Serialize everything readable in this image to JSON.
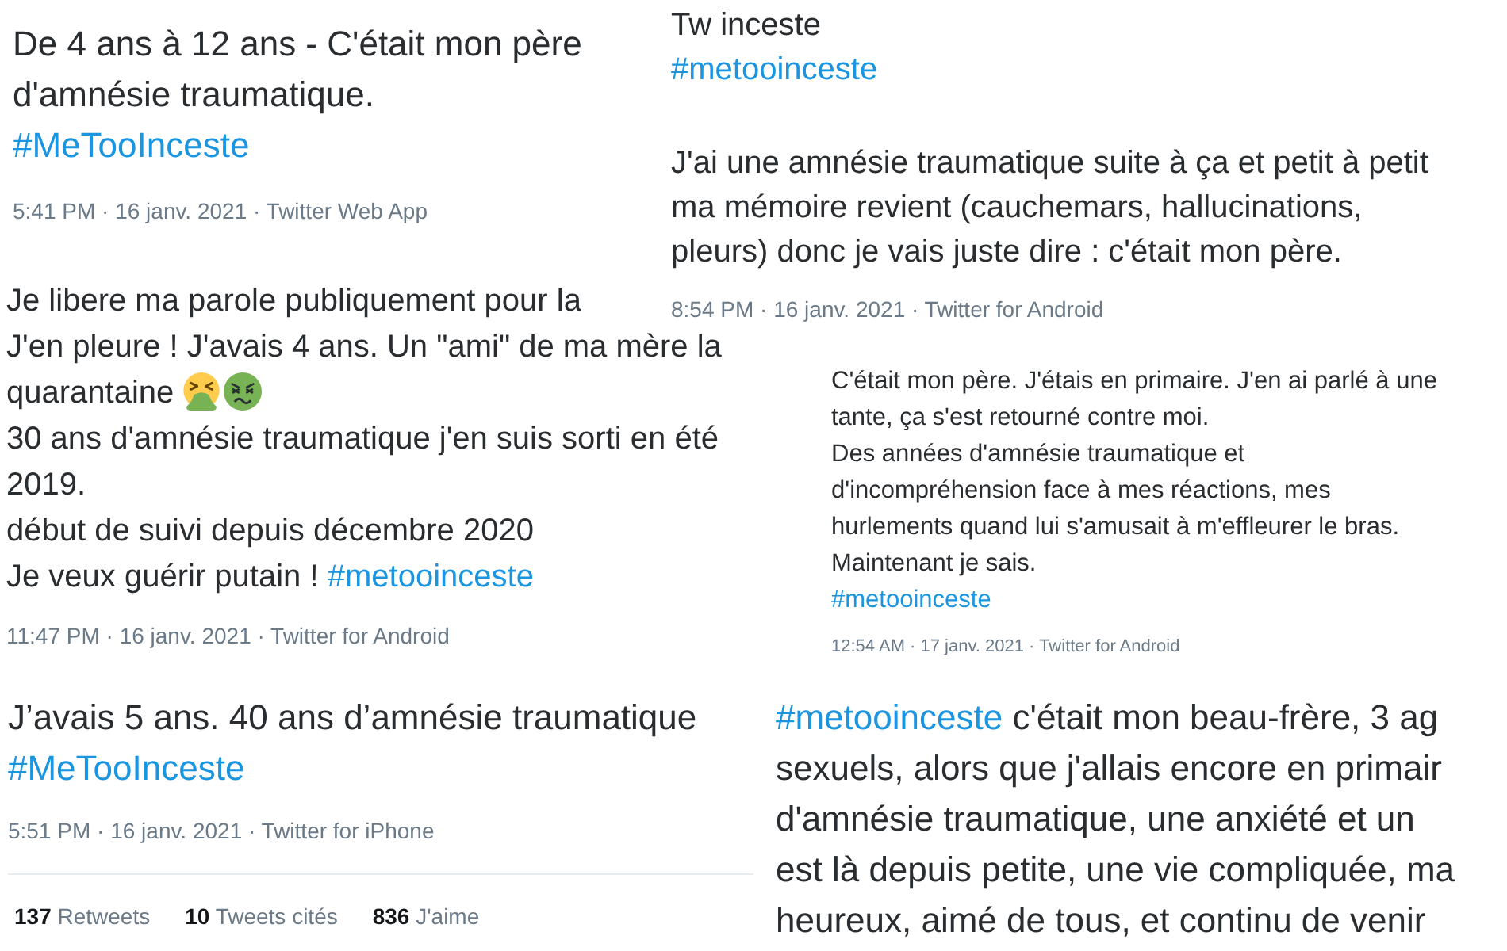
{
  "tweets": [
    {
      "paragraphs": [
        [
          [
            {
              "kind": "text",
              "text": "De 4 ans à 12 ans - C'était mon père"
            }
          ],
          [
            {
              "kind": "text",
              "text": "d'amnésie traumatique."
            }
          ],
          [
            {
              "kind": "hashtag",
              "text": "#MeTooInceste"
            }
          ]
        ]
      ],
      "meta": "5:41 PM · 16 janv. 2021 · Twitter Web App"
    },
    {
      "paragraphs": [
        [
          [
            {
              "kind": "text",
              "text": "Tw inceste"
            }
          ],
          [
            {
              "kind": "hashtag",
              "text": "#metooinceste"
            }
          ]
        ],
        [
          [
            {
              "kind": "text",
              "text": "J'ai une amnésie traumatique suite à ça et petit à petit"
            }
          ],
          [
            {
              "kind": "text",
              "text": "ma mémoire revient (cauchemars, hallucinations,"
            }
          ],
          [
            {
              "kind": "text",
              "text": "pleurs) donc je vais juste dire : c'était mon père."
            }
          ]
        ]
      ],
      "meta": "8:54 PM · 16 janv. 2021 · Twitter for Android"
    },
    {
      "paragraphs": [
        [
          [
            {
              "kind": "text",
              "text": "Je libere ma parole publiquement pour la"
            }
          ],
          [
            {
              "kind": "text",
              "text": "J'en pleure ! J'avais 4 ans. Un \"ami\" de ma mère la"
            }
          ],
          [
            {
              "kind": "text",
              "text": "quarantaine"
            },
            {
              "kind": "vomit"
            },
            {
              "kind": "nausea"
            }
          ],
          [
            {
              "kind": "text",
              "text": "30 ans d'amnésie traumatique j'en suis sorti en été"
            }
          ],
          [
            {
              "kind": "text",
              "text": "2019."
            }
          ],
          [
            {
              "kind": "text",
              "text": "début de suivi depuis décembre 2020"
            }
          ],
          [
            {
              "kind": "text",
              "text": "Je veux guérir putain !"
            },
            {
              "kind": "hashtag",
              "text": "#metooinceste"
            }
          ]
        ]
      ],
      "meta": "11:47 PM · 16 janv. 2021 · Twitter for Android"
    },
    {
      "paragraphs": [
        [
          [
            {
              "kind": "text",
              "text": "C'était mon père. J'étais en primaire. J'en ai parlé à une"
            }
          ],
          [
            {
              "kind": "text",
              "text": "tante, ça s'est retourné contre moi."
            }
          ],
          [
            {
              "kind": "text",
              "text": "Des années d'amnésie traumatique et"
            }
          ],
          [
            {
              "kind": "text",
              "text": "d'incompréhension face à mes réactions, mes"
            }
          ],
          [
            {
              "kind": "text",
              "text": "hurlements quand lui s'amusait à m'effleurer le bras."
            }
          ],
          [
            {
              "kind": "text",
              "text": "Maintenant je sais."
            }
          ],
          [
            {
              "kind": "hashtag",
              "text": "#metooinceste"
            }
          ]
        ]
      ],
      "meta": "12:54 AM · 17 janv. 2021 · Twitter for Android"
    },
    {
      "paragraphs": [
        [
          [
            {
              "kind": "text",
              "text": "J’avais 5 ans. 40 ans d’amnésie traumatique"
            }
          ],
          [
            {
              "kind": "hashtag",
              "text": "#MeTooInceste"
            }
          ]
        ]
      ],
      "meta": "5:51 PM · 16 janv. 2021 · Twitter for iPhone",
      "stats": [
        {
          "count": "137",
          "label": "Retweets"
        },
        {
          "count": "10",
          "label": "Tweets cités"
        },
        {
          "count": "836",
          "label": "J'aime"
        }
      ]
    },
    {
      "paragraphs": [
        [
          [
            {
              "kind": "hashtag",
              "text": "#metooinceste"
            },
            {
              "kind": "text",
              "text": "c'était mon beau-frère, 3 ag"
            }
          ],
          [
            {
              "kind": "text",
              "text": "sexuels, alors que j'allais encore en primair"
            }
          ],
          [
            {
              "kind": "text",
              "text": "d'amnésie traumatique, une anxiété et un"
            }
          ],
          [
            {
              "kind": "text",
              "text": "est là depuis petite, une vie compliquée, ma"
            }
          ],
          [
            {
              "kind": "text",
              "text": "heureux, aimé de tous, et continu de venir"
            }
          ]
        ]
      ]
    }
  ]
}
